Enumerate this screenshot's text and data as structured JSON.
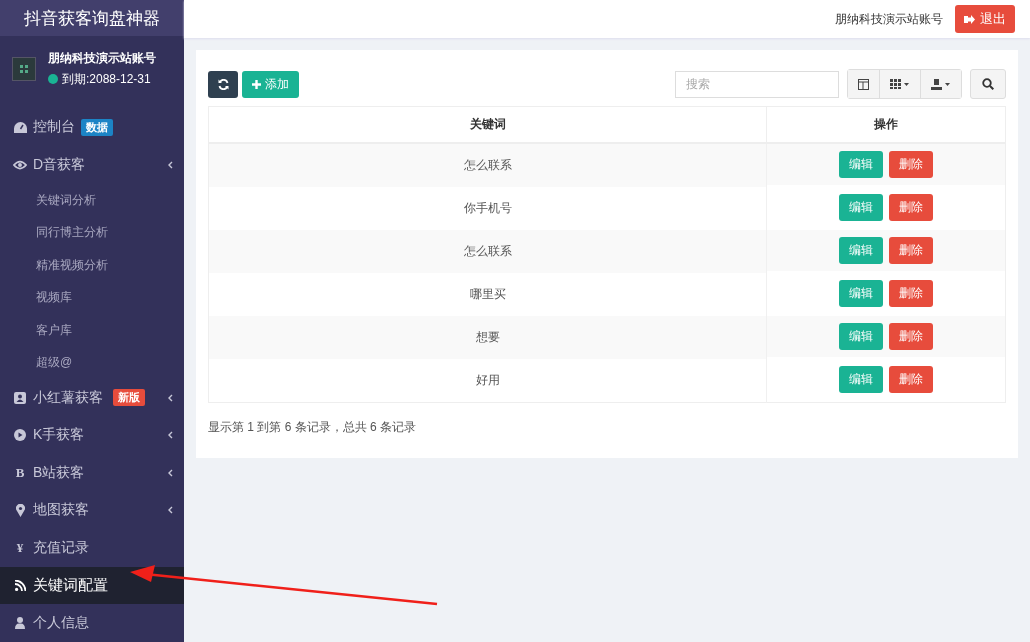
{
  "sidebar": {
    "brand": "抖音获客询盘神器",
    "user": {
      "name": "朋纳科技演示站账号",
      "expiry": "到期:2088-12-31"
    },
    "items": [
      {
        "kind": "link",
        "label": "控制台",
        "badge": {
          "text": "数据",
          "color": "#1c84c6"
        },
        "selected": false
      },
      {
        "kind": "group",
        "label": "D音获客",
        "selected": false,
        "children": [
          {
            "label": "关键词分析"
          },
          {
            "label": "同行博主分析"
          },
          {
            "label": "精准视频分析"
          },
          {
            "label": "视频库"
          },
          {
            "label": "客户库"
          },
          {
            "label": "超级@"
          }
        ]
      },
      {
        "kind": "group",
        "label": "小红薯获客",
        "badge": {
          "text": "新版",
          "color": "#e74c3c"
        },
        "selected": false
      },
      {
        "kind": "group",
        "label": "K手获客",
        "selected": false
      },
      {
        "kind": "group",
        "glyph": "B",
        "label": "B站获客",
        "selected": false
      },
      {
        "kind": "group",
        "label": "地图获客",
        "selected": false
      },
      {
        "kind": "link",
        "glyph": "¥",
        "label": "充值记录",
        "selected": false
      },
      {
        "kind": "link",
        "label": "关键词配置",
        "selected": true
      },
      {
        "kind": "link",
        "label": "个人信息",
        "selected": false
      }
    ]
  },
  "header": {
    "account": "朋纳科技演示站账号",
    "logout": "退出"
  },
  "toolbar": {
    "add": "添加",
    "search": {
      "placeholder": "搜索"
    }
  },
  "table": {
    "columns": [
      "关键词",
      "操作"
    ],
    "rows": [
      {
        "keyword": "怎么联系",
        "edit": "编辑",
        "delete": "删除"
      },
      {
        "keyword": "你手机号",
        "edit": "编辑",
        "delete": "删除"
      },
      {
        "keyword": "怎么联系",
        "edit": "编辑",
        "delete": "删除"
      },
      {
        "keyword": "哪里买",
        "edit": "编辑",
        "delete": "删除"
      },
      {
        "keyword": "想要",
        "edit": "编辑",
        "delete": "删除"
      },
      {
        "keyword": "好用",
        "edit": "编辑",
        "delete": "删除"
      }
    ],
    "summary": "显示第 1 到第 6 条记录，总共 6 条记录"
  }
}
